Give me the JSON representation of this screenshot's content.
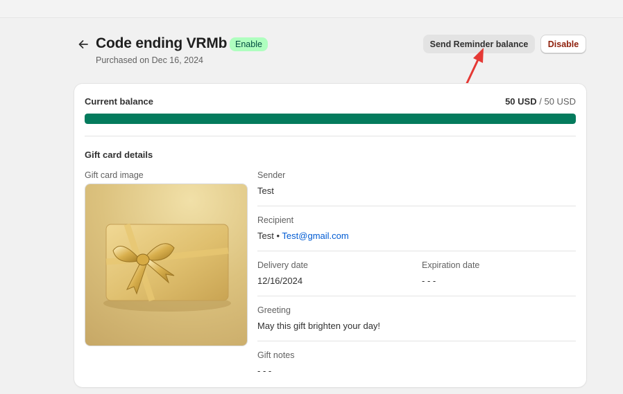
{
  "header": {
    "title": "Code ending VRMb",
    "status_badge": "Enable",
    "subtitle": "Purchased on Dec 16, 2024",
    "send_reminder_label": "Send Reminder balance",
    "disable_label": "Disable"
  },
  "balance": {
    "label": "Current balance",
    "current": "50 USD",
    "separator": "/",
    "total": "50 USD",
    "fraction": 1.0
  },
  "details": {
    "title": "Gift card details",
    "image_label": "Gift card image",
    "sender_label": "Sender",
    "sender_value": "Test",
    "recipient_label": "Recipient",
    "recipient_name": "Test",
    "recipient_separator": "•",
    "recipient_email": "Test@gmail.com",
    "delivery_label": "Delivery date",
    "delivery_value": "12/16/2024",
    "expiration_label": "Expiration date",
    "expiration_value": "- - -",
    "greeting_label": "Greeting",
    "greeting_value": "May this gift brighten your day!",
    "notes_label": "Gift notes",
    "notes_value": "- - -"
  },
  "colors": {
    "badge_bg": "#affebf",
    "balance_fill": "#047b5d",
    "disable_text": "#8e1f0b",
    "link": "#005bd3",
    "annotation_arrow": "#e53935"
  },
  "icons": {
    "back": "arrow-left-icon"
  }
}
